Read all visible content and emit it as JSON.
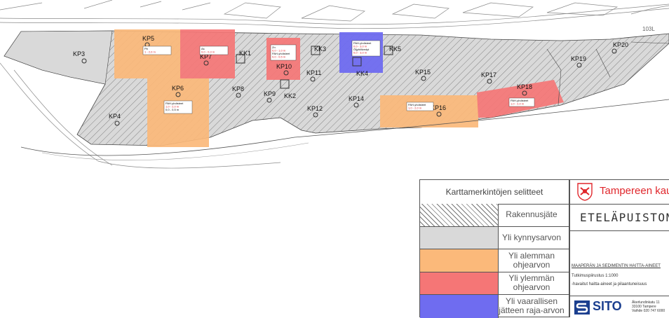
{
  "map": {
    "points": [
      {
        "id": "kp3",
        "label": "KP3"
      },
      {
        "id": "kp4",
        "label": "KP4"
      },
      {
        "id": "kp5",
        "label": "KP5"
      },
      {
        "id": "kp6",
        "label": "KP6"
      },
      {
        "id": "kp7",
        "label": "KP7"
      },
      {
        "id": "kp8",
        "label": "KP8"
      },
      {
        "id": "kp9",
        "label": "KP9"
      },
      {
        "id": "kp10",
        "label": "KP10"
      },
      {
        "id": "kp11",
        "label": "KP11"
      },
      {
        "id": "kp12",
        "label": "KP12"
      },
      {
        "id": "kp14",
        "label": "KP14"
      },
      {
        "id": "kp15",
        "label": "KP15"
      },
      {
        "id": "kp16",
        "label": "KP16"
      },
      {
        "id": "kp17",
        "label": "KP17"
      },
      {
        "id": "kp18",
        "label": "KP18"
      },
      {
        "id": "kp19",
        "label": "KP19"
      },
      {
        "id": "kp20",
        "label": "KP20"
      }
    ],
    "wells": [
      {
        "id": "kk1",
        "label": "KK1"
      },
      {
        "id": "kk2",
        "label": "KK2"
      },
      {
        "id": "kk3",
        "label": "KK3"
      },
      {
        "id": "kk4",
        "label": "KK4"
      },
      {
        "id": "kk5",
        "label": "KK5"
      }
    ],
    "notes": {
      "kp5": [
        "Pb",
        "1 - 2,0 m"
      ],
      "kp7": [
        "As",
        "0,0 - 0,3 m"
      ],
      "kp10": [
        "Zn",
        "0,0 - 1,0 m",
        "PAH-yhdisteet",
        "0,0 - 0,5 m"
      ],
      "kk4": [
        "PAH-yhdisteet",
        "0,0 - 3,0 m",
        "Öljyhiilivedyt",
        "0,0 - 3,0 m"
      ],
      "kp6": [
        "PAH-yhdisteet",
        "1,0 - 2,0 m",
        "0,0 - 0,5 m"
      ],
      "kp16": [
        "PAH-yhdisteet",
        "1,0 - 2,0 m"
      ],
      "kp18": [
        "PAH-yhdisteet",
        "1,0 - 2,0 m"
      ]
    },
    "street_labels": {
      "right_edge": "103L"
    }
  },
  "legend": {
    "title": "Karttamerkintöjen selitteet",
    "rows": [
      {
        "id": "rakennusjate",
        "lines": [
          "Rakennusjäte"
        ],
        "color": "#ffffff",
        "hatch": true
      },
      {
        "id": "kynnys",
        "lines": [
          "Yli kynnysarvon"
        ],
        "color": "#d9d9d9",
        "hatch": false
      },
      {
        "id": "alempi",
        "lines": [
          "Yli alemman",
          "ohjearvon"
        ],
        "color": "#fbb97a",
        "hatch": false
      },
      {
        "id": "ylempi",
        "lines": [
          "Yli ylemmän",
          "ohjearvon"
        ],
        "color": "#f57676",
        "hatch": false
      },
      {
        "id": "raja",
        "lines": [
          "Yli vaarallisen",
          "jätteen raja-arvon"
        ],
        "color": "#6f6cf0",
        "hatch": false
      }
    ]
  },
  "titleblock": {
    "city": "Tampereen kaupunki",
    "project": "ETELÄPUISTON ASEMAKAAVA",
    "subtitle": "MAAPERÄN JA SEDIMENTIN HAITTA-AINEET",
    "scale": "Tutkimuspiirustus  1:1000",
    "description": "-havaitut haitta-aineet ja pilaantuneisuus",
    "company": "SITO",
    "address": [
      "Äkerlundinkatu 11",
      "33100 Tampere",
      "Vaihde 020 747 6000"
    ]
  },
  "colors": {
    "orange": "#fbb97a",
    "red": "#f57676",
    "blue": "#6f6cf0",
    "grey": "#d9d9d9",
    "city_red": "#e0262b",
    "sito_blue": "#1b3f8f"
  }
}
